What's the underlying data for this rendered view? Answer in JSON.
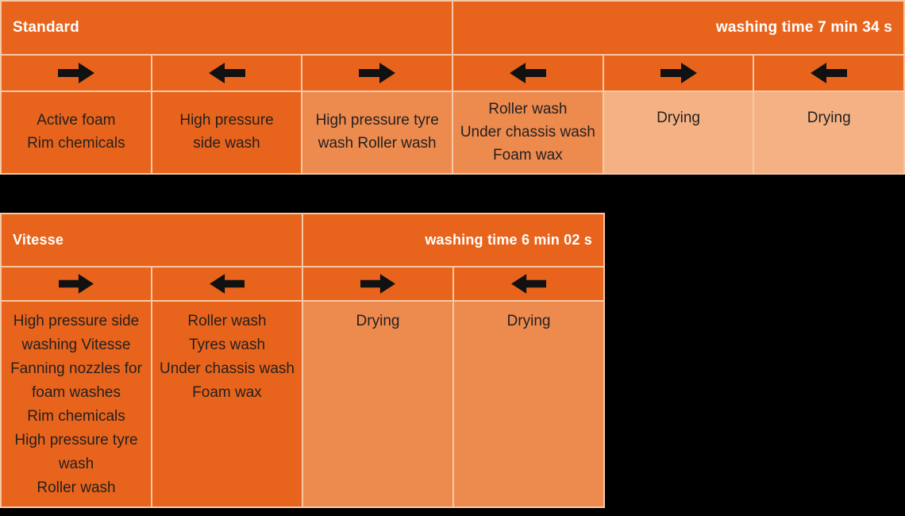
{
  "background_color": "#000000",
  "palette": {
    "dark_orange": "#E8641C",
    "mid_orange": "#ED8B4F",
    "light_orange": "#F4B183",
    "gridline": "#F7C8A5",
    "header_text": "#FFFFFF",
    "body_text": "#231F20"
  },
  "tables": [
    {
      "id": "standard",
      "header": {
        "title": "Standard",
        "washing_time_label": "washing time 7 min 34 s"
      },
      "columns": [
        {
          "direction_icon": "arrow-right-icon",
          "direction": "right",
          "tone": "dark",
          "lines": [
            "Active foam",
            "Rim chemicals"
          ],
          "text": "Active foam\nRim chemicals"
        },
        {
          "direction_icon": "arrow-left-icon",
          "direction": "left",
          "tone": "dark",
          "lines": [
            "High pressure",
            "side wash"
          ],
          "text": "High pressure\nside wash"
        },
        {
          "direction_icon": "arrow-right-icon",
          "direction": "right",
          "tone": "mid",
          "lines": [
            "High pressure tyre",
            "wash Roller wash"
          ],
          "text": "High pressure tyre\nwash Roller wash"
        },
        {
          "direction_icon": "arrow-left-icon",
          "direction": "left",
          "tone": "mid",
          "lines": [
            "Roller wash",
            "Under chassis wash",
            "Foam wax"
          ],
          "text": "Roller wash\nUnder chassis wash\nFoam wax"
        },
        {
          "direction_icon": "arrow-right-icon",
          "direction": "right",
          "tone": "light",
          "lines": [
            "Drying"
          ],
          "text": "Drying"
        },
        {
          "direction_icon": "arrow-left-icon",
          "direction": "left",
          "tone": "light",
          "lines": [
            "Drying"
          ],
          "text": "Drying"
        }
      ]
    },
    {
      "id": "vitesse",
      "header": {
        "title": "Vitesse",
        "washing_time_label": "washing time 6 min 02 s"
      },
      "columns": [
        {
          "direction_icon": "arrow-right-icon",
          "direction": "right",
          "tone": "dark",
          "lines": [
            "High pressure side",
            "washing Vitesse",
            "Fanning nozzles for",
            "foam washes",
            "Rim chemicals",
            "High pressure tyre",
            "wash",
            "Roller wash"
          ],
          "text": "High pressure side washing Vitesse Fanning nozzles for foam washes Rim chemicals High pressure tyre wash Roller wash"
        },
        {
          "direction_icon": "arrow-left-icon",
          "direction": "left",
          "tone": "dark",
          "lines": [
            "Roller wash",
            "Tyres wash",
            "Under chassis wash",
            "Foam wax"
          ],
          "text": "Roller wash Tyres wash Under chassis wash Foam wax"
        },
        {
          "direction_icon": "arrow-right-icon",
          "direction": "right",
          "tone": "mid",
          "lines": [
            "Drying"
          ],
          "text": "Drying"
        },
        {
          "direction_icon": "arrow-left-icon",
          "direction": "left",
          "tone": "mid",
          "lines": [
            "Drying"
          ],
          "text": "Drying"
        }
      ]
    }
  ]
}
